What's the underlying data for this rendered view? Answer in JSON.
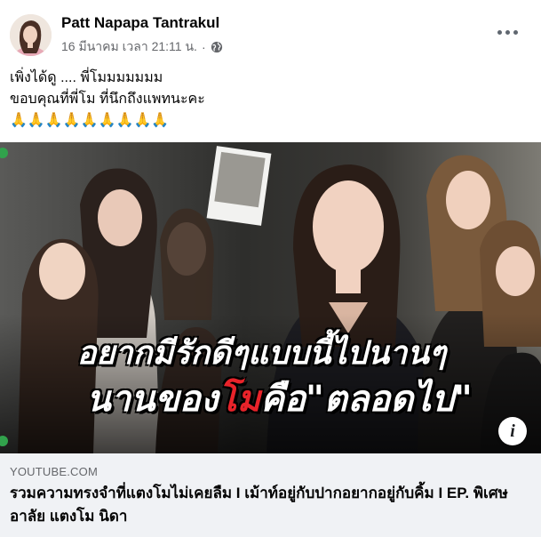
{
  "post": {
    "author": "Patt Napapa Tantrakul",
    "timestamp": "16 มีนาคม เวลา 21:11 น.",
    "separator": "·",
    "privacy_icon": "globe-icon",
    "more_icon": "more-options-icon",
    "caption_lines": [
      "เพิ่งได้ดู .... พี่โมมมมมมม",
      "ขอบคุณที่พี่โม ที่นึกถึงแพทนะคะ",
      "🙏🙏🙏🙏🙏🙏🙏🙏🙏"
    ]
  },
  "media": {
    "headline_line1": "อยากมีรักดีๆแบบนี้ไปนานๆ",
    "headline_line2_prefix": "นานของ",
    "headline_line2_red": "โม",
    "headline_line2_suffix": "คือ\"ตลอดไป\"",
    "info_label": "i",
    "info_icon": "info-icon"
  },
  "link_preview": {
    "domain": "YOUTUBE.COM",
    "title": "รวมความทรงจำที่แตงโมไม่เคยลืม I เม้าท์อยู่กับปากอยากอยู่กับคิ้ม I EP. พิเศษ อาลัย แตงโม นิดา"
  },
  "colors": {
    "meta_gray": "#65676b",
    "link_bg": "#f0f2f5",
    "headline_red": "#e8232a"
  }
}
